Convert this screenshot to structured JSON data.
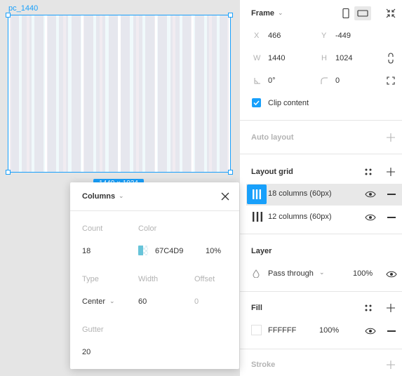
{
  "canvas": {
    "frame_label": "pc_1440",
    "size_badge": "1440 × 1024"
  },
  "popover": {
    "title": "Columns",
    "count_label": "Count",
    "count_value": "18",
    "color_label": "Color",
    "color_hex": "67C4D9",
    "color_opacity": "10%",
    "type_label": "Type",
    "type_value": "Center",
    "width_label": "Width",
    "width_value": "60",
    "offset_label": "Offset",
    "offset_value": "0",
    "gutter_label": "Gutter",
    "gutter_value": "20"
  },
  "panel": {
    "frame": {
      "title": "Frame",
      "x_label": "X",
      "x_value": "466",
      "y_label": "Y",
      "y_value": "-449",
      "w_label": "W",
      "w_value": "1440",
      "h_label": "H",
      "h_value": "1024",
      "rotation_value": "0°",
      "radius_value": "0",
      "clip_label": "Clip content",
      "clip_checked": true
    },
    "auto_layout": {
      "title": "Auto layout"
    },
    "layout_grid": {
      "title": "Layout grid",
      "items": [
        {
          "label": "18 columns (60px)",
          "selected": true
        },
        {
          "label": "12 columns (60px)",
          "selected": false
        }
      ]
    },
    "layer": {
      "title": "Layer",
      "blend_mode": "Pass through",
      "opacity": "100%"
    },
    "fill": {
      "title": "Fill",
      "hex": "FFFFFF",
      "opacity": "100%"
    },
    "stroke": {
      "title": "Stroke"
    }
  },
  "colors": {
    "accent": "#18a0fb",
    "grid_color": "#67c4d9"
  }
}
